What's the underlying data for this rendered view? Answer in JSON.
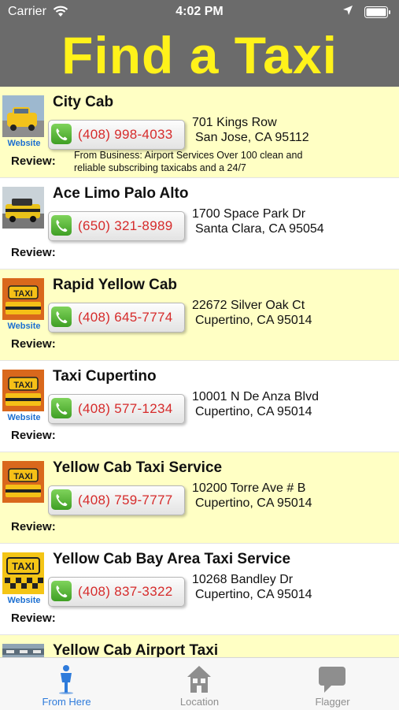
{
  "status_bar": {
    "carrier": "Carrier",
    "time": "4:02 PM"
  },
  "header": {
    "title": "Find a Taxi"
  },
  "listings": [
    {
      "name": "City Cab",
      "phone": "(408) 998-4033",
      "address_line1": "701 Kings Row",
      "address_line2": "San Jose, CA 95112",
      "website": "Website",
      "review_label": "Review:",
      "review_text": "From Business: Airport Services Over 100 clean and reliable subscribing taxicabs and a 24/7"
    },
    {
      "name": "Ace Limo Palo Alto",
      "phone": "(650) 321-8989",
      "address_line1": "1700 Space Park Dr",
      "address_line2": "Santa Clara, CA 95054",
      "website": "",
      "review_label": "Review:",
      "review_text": ""
    },
    {
      "name": "Rapid Yellow Cab",
      "phone": "(408) 645-7774",
      "address_line1": "22672 Silver Oak Ct",
      "address_line2": "Cupertino, CA 95014",
      "website": "Website",
      "review_label": "Review:",
      "review_text": ""
    },
    {
      "name": "Taxi Cupertino",
      "phone": "(408) 577-1234",
      "address_line1": "10001 N De Anza Blvd",
      "address_line2": "Cupertino, CA 95014",
      "website": "Website",
      "review_label": "Review:",
      "review_text": ""
    },
    {
      "name": "Yellow Cab Taxi Service",
      "phone": "(408) 759-7777",
      "address_line1": "10200 Torre Ave # B",
      "address_line2": "Cupertino, CA 95014",
      "website": "",
      "review_label": "Review:",
      "review_text": ""
    },
    {
      "name": "Yellow Cab Bay Area Taxi Service",
      "phone": "(408) 837-3322",
      "address_line1": "10268 Bandley Dr",
      "address_line2": "Cupertino, CA 95014",
      "website": "Website",
      "review_label": "Review:",
      "review_text": ""
    },
    {
      "name": "Yellow Cab Airport Taxi",
      "phone": "",
      "address_line1": "",
      "address_line2": "",
      "website": "",
      "review_label": "",
      "review_text": ""
    }
  ],
  "tabs": [
    {
      "label": "From Here",
      "icon": "person-icon",
      "active": true
    },
    {
      "label": "Location",
      "icon": "house-icon",
      "active": false
    },
    {
      "label": "Flagger",
      "icon": "speech-bubble-icon",
      "active": false
    }
  ],
  "colors": {
    "header_bg": "#6b6b6b",
    "title": "#fff21a",
    "row_yellow": "#ffffc4",
    "phone_text": "#d62b2b",
    "link": "#1c6fd1",
    "tab_active": "#2e7bdb"
  }
}
